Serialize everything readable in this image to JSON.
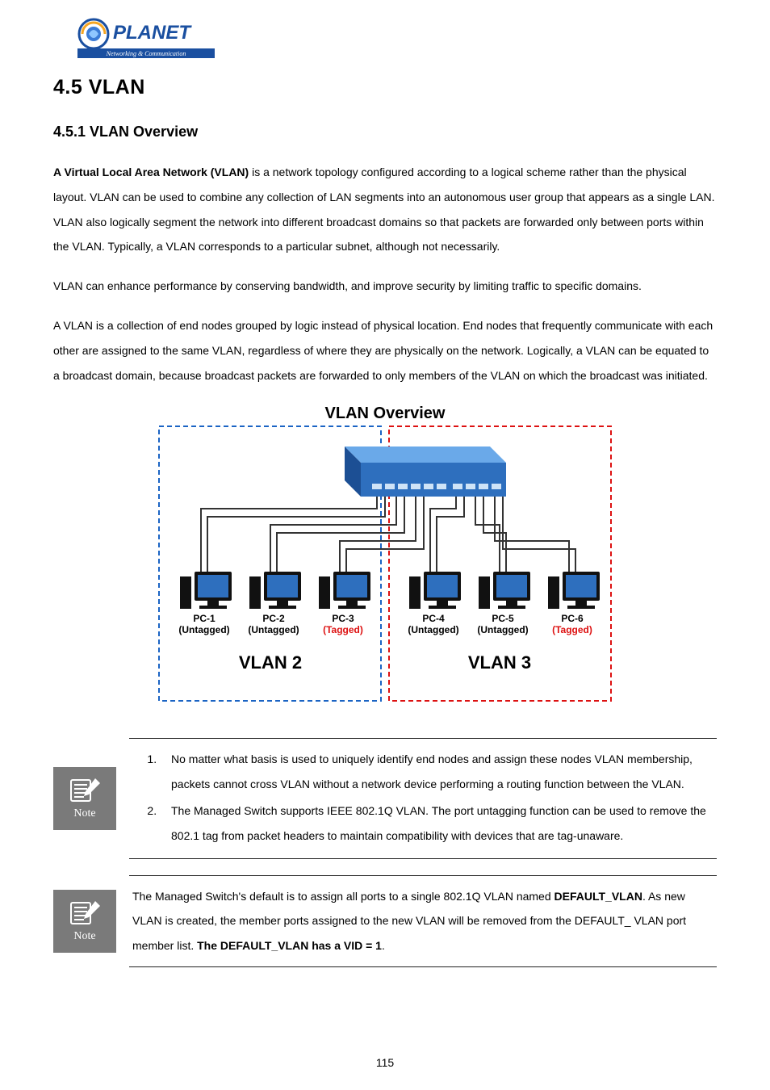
{
  "logo": {
    "brand_text": "PLANET",
    "tagline": "Networking & Communication"
  },
  "section": {
    "title": "4.5 VLAN",
    "subsection_title": "4.5.1 VLAN Overview"
  },
  "paragraphs": {
    "p1_bold": "A Virtual Local Area Network (VLAN)",
    "p1_rest": " is a network topology configured according to a logical scheme rather than the physical layout. VLAN can be used to combine any collection of LAN segments into an autonomous user group that appears as a single LAN. VLAN also logically segment the network into different broadcast domains so that packets are forwarded only between ports within the VLAN. Typically, a VLAN corresponds to a particular subnet, although not necessarily.",
    "p2": "VLAN can enhance performance by conserving bandwidth, and improve security by limiting traffic to specific domains.",
    "p3": "A VLAN is a collection of end nodes grouped by logic instead of physical location. End nodes that frequently communicate with each other are assigned to the same VLAN, regardless of where they are physically on the network. Logically, a VLAN can be equated to a broadcast domain, because broadcast packets are forwarded to only members of the VLAN on which the broadcast was initiated."
  },
  "diagram": {
    "title": "VLAN Overview",
    "vlan2_label": "VLAN 2",
    "vlan3_label": "VLAN 3",
    "pcs": [
      {
        "name": "PC-1",
        "tag": "(Untagged)",
        "red": false
      },
      {
        "name": "PC-2",
        "tag": "(Untagged)",
        "red": false
      },
      {
        "name": "PC-3",
        "tag": "(Tagged)",
        "red": true
      },
      {
        "name": "PC-4",
        "tag": "(Untagged)",
        "red": false
      },
      {
        "name": "PC-5",
        "tag": "(Untagged)",
        "red": false
      },
      {
        "name": "PC-6",
        "tag": "(Tagged)",
        "red": true
      }
    ]
  },
  "notes": {
    "badge_label": "Note",
    "note1_items": [
      "No matter what basis is used to uniquely identify end nodes and assign these nodes VLAN membership, packets cannot cross VLAN without a network device performing a routing function between the VLAN.",
      "The Managed Switch supports IEEE 802.1Q VLAN. The port untagging function can be used to remove the 802.1 tag from packet headers to maintain compatibility with devices that are tag-unaware."
    ],
    "note2_pre": "The Managed Switch's default is to assign all ports to a single 802.1Q VLAN named ",
    "note2_bold1": "DEFAULT_VLAN",
    "note2_mid": ". As new VLAN is created, the member ports assigned to the new VLAN will be removed from the DEFAULT_ VLAN port member list. ",
    "note2_bold2": "The DEFAULT_VLAN has a VID = 1",
    "note2_post": "."
  },
  "page_number": "115"
}
